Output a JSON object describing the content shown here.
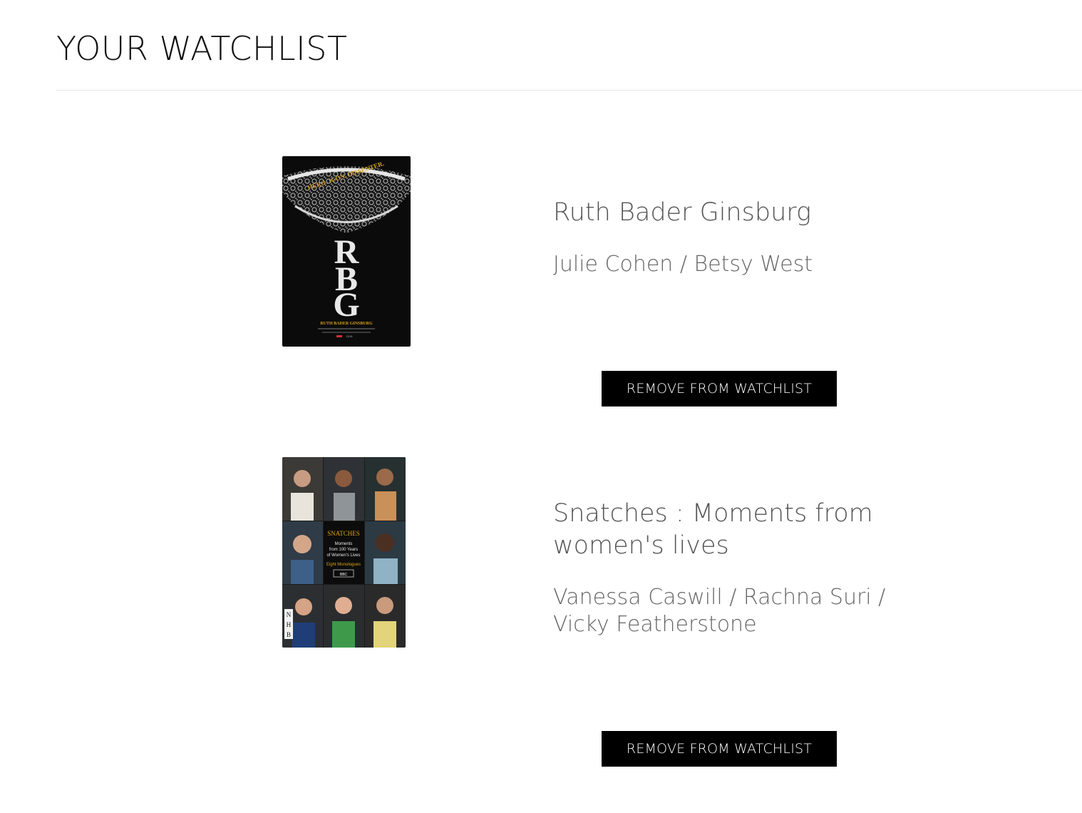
{
  "page": {
    "title": "YOUR WATCHLIST"
  },
  "items": [
    {
      "title": "Ruth Bader Ginsburg",
      "authors": "Julie Cohen / Betsy West",
      "remove_label": "REMOVE FROM WATCHLIST",
      "poster": {
        "tagline": "HERO. ICON. DISSENTER.",
        "letters": [
          "R",
          "B",
          "G"
        ],
        "subtitle": "RUTH BADER GINSBURG",
        "footer": "2018"
      }
    },
    {
      "title": "Snatches : Moments from women's lives",
      "authors": "Vanessa Caswill / Rachna Suri / Vicky Featherstone",
      "remove_label": "REMOVE FROM WATCHLIST",
      "poster": {
        "heading": "SNATCHES",
        "subheading": "Moments from 100 Years of Women's Lives",
        "note": "Eight Monologues",
        "badge": "BBC",
        "publisher": [
          "N",
          "H",
          "B"
        ]
      }
    }
  ],
  "colors": {
    "button_bg": "#000000",
    "button_text": "#ffffff",
    "title_text": "#555555",
    "poster_gold": "#d9a21b"
  }
}
